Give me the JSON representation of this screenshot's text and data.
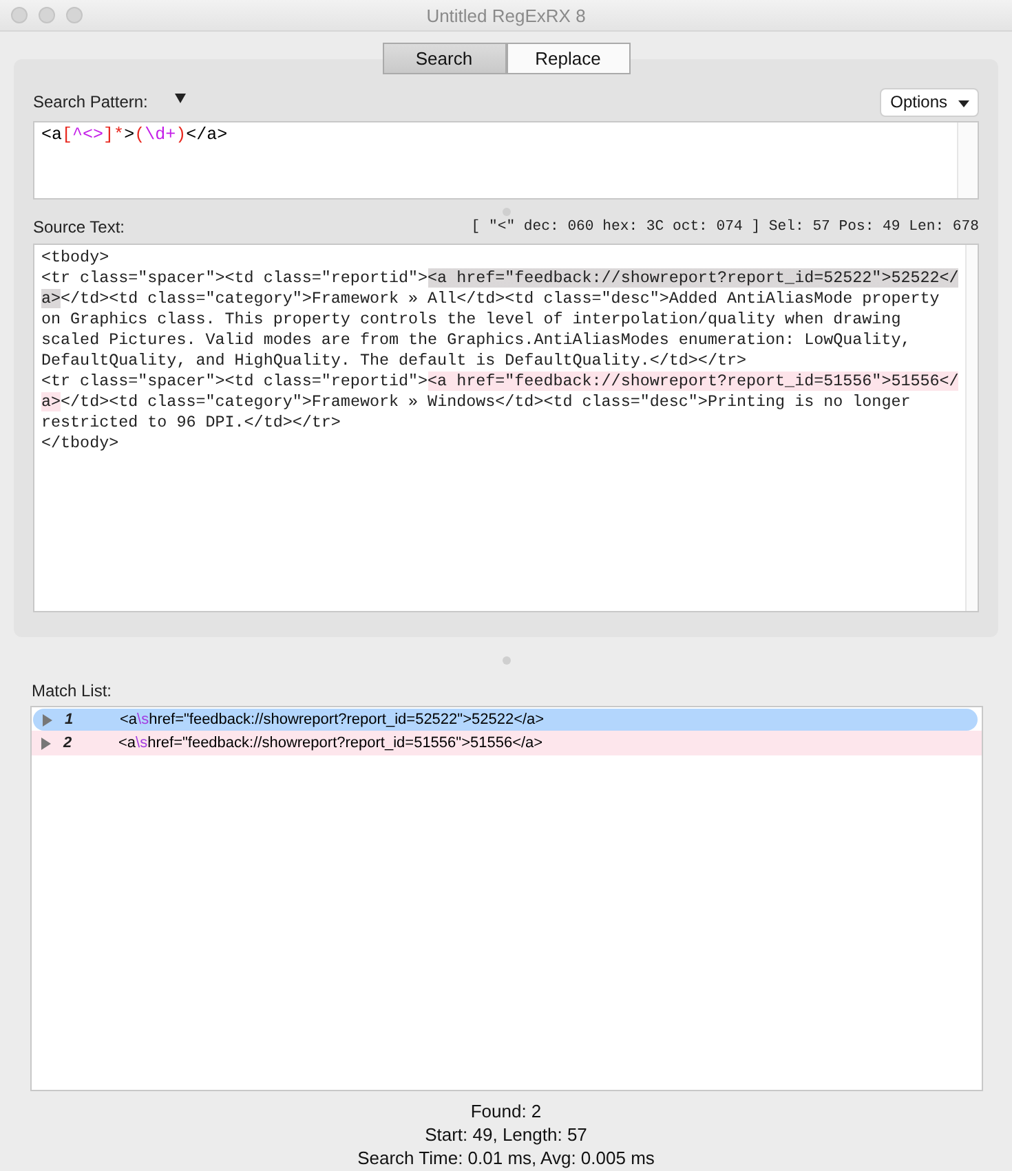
{
  "window": {
    "title": "Untitled RegExRX 8"
  },
  "tabs": [
    {
      "label": "Search",
      "selected": true
    },
    {
      "label": "Replace",
      "selected": false
    }
  ],
  "search_pattern": {
    "label": "Search Pattern:",
    "options_button": "Options",
    "tokens": [
      {
        "text": "<a",
        "color": "#000000"
      },
      {
        "text": "[",
        "color": "#e8271e"
      },
      {
        "text": "^<>",
        "color": "#c41ee8"
      },
      {
        "text": "]*",
        "color": "#e8271e"
      },
      {
        "text": ">",
        "color": "#000000"
      },
      {
        "text": "(",
        "color": "#e8271e"
      },
      {
        "text": "\\d+",
        "color": "#c41ee8"
      },
      {
        "text": ")",
        "color": "#e8271e"
      },
      {
        "text": "</a>",
        "color": "#000000"
      }
    ]
  },
  "source_text": {
    "label": "Source Text:",
    "info": "[ \"<\" dec: 060 hex: 3C oct: 074 ] Sel: 57 Pos: 49 Len: 678",
    "lines": [
      [
        {
          "text": "<tbody>",
          "match": false,
          "selected": false
        }
      ],
      [
        {
          "text": "<tr class=\"spacer\"><td class=\"reportid\">",
          "match": false,
          "selected": false
        },
        {
          "text": "<a href=\"feedback://showreport?report_id=52522\">52522</",
          "match": true,
          "selected": true
        }
      ],
      [
        {
          "text": "a>",
          "match": true,
          "selected": true
        },
        {
          "text": "</td><td class=\"category\">Framework » All</td><td class=\"desc\">Added AntiAliasMode property",
          "match": false,
          "selected": false
        }
      ],
      [
        {
          "text": "on Graphics class. This property controls the level of interpolation/quality when drawing",
          "match": false,
          "selected": false
        }
      ],
      [
        {
          "text": "scaled Pictures. Valid modes are from the Graphics.AntiAliasModes enumeration: LowQuality,",
          "match": false,
          "selected": false
        }
      ],
      [
        {
          "text": "DefaultQuality, and HighQuality. The default is DefaultQuality.</td></tr>",
          "match": false,
          "selected": false
        }
      ],
      [
        {
          "text": "<tr class=\"spacer\"><td class=\"reportid\">",
          "match": false,
          "selected": false
        },
        {
          "text": "<a href=\"feedback://showreport?report_id=51556\">51556</",
          "match": true,
          "selected": false
        }
      ],
      [
        {
          "text": "a>",
          "match": true,
          "selected": false
        },
        {
          "text": "</td><td class=\"category\">Framework » Windows</td><td class=\"desc\">Printing is no longer",
          "match": false,
          "selected": false
        }
      ],
      [
        {
          "text": "restricted to 96 DPI.</td></tr>",
          "match": false,
          "selected": false
        }
      ],
      [
        {
          "text": "</tbody>",
          "match": false,
          "selected": false
        }
      ]
    ]
  },
  "match_list": {
    "label": "Match List:",
    "rows": [
      {
        "number": "1",
        "selected": true,
        "tokens": [
          {
            "text": "<a",
            "color": "#000000"
          },
          {
            "text": "\\s",
            "color": "#a23de0"
          },
          {
            "text": "href=\"feedback://showreport?report_id=52522\">52522</a>",
            "color": "#000000"
          }
        ]
      },
      {
        "number": "2",
        "selected": false,
        "tokens": [
          {
            "text": "<a",
            "color": "#000000"
          },
          {
            "text": "\\s",
            "color": "#a23de0"
          },
          {
            "text": "href=\"feedback://showreport?report_id=51556\">51556</a>",
            "color": "#000000"
          }
        ]
      }
    ]
  },
  "status": [
    "Found: 2",
    "Start: 49, Length: 57",
    "Search Time: 0.01 ms, Avg: 0.005 ms"
  ]
}
